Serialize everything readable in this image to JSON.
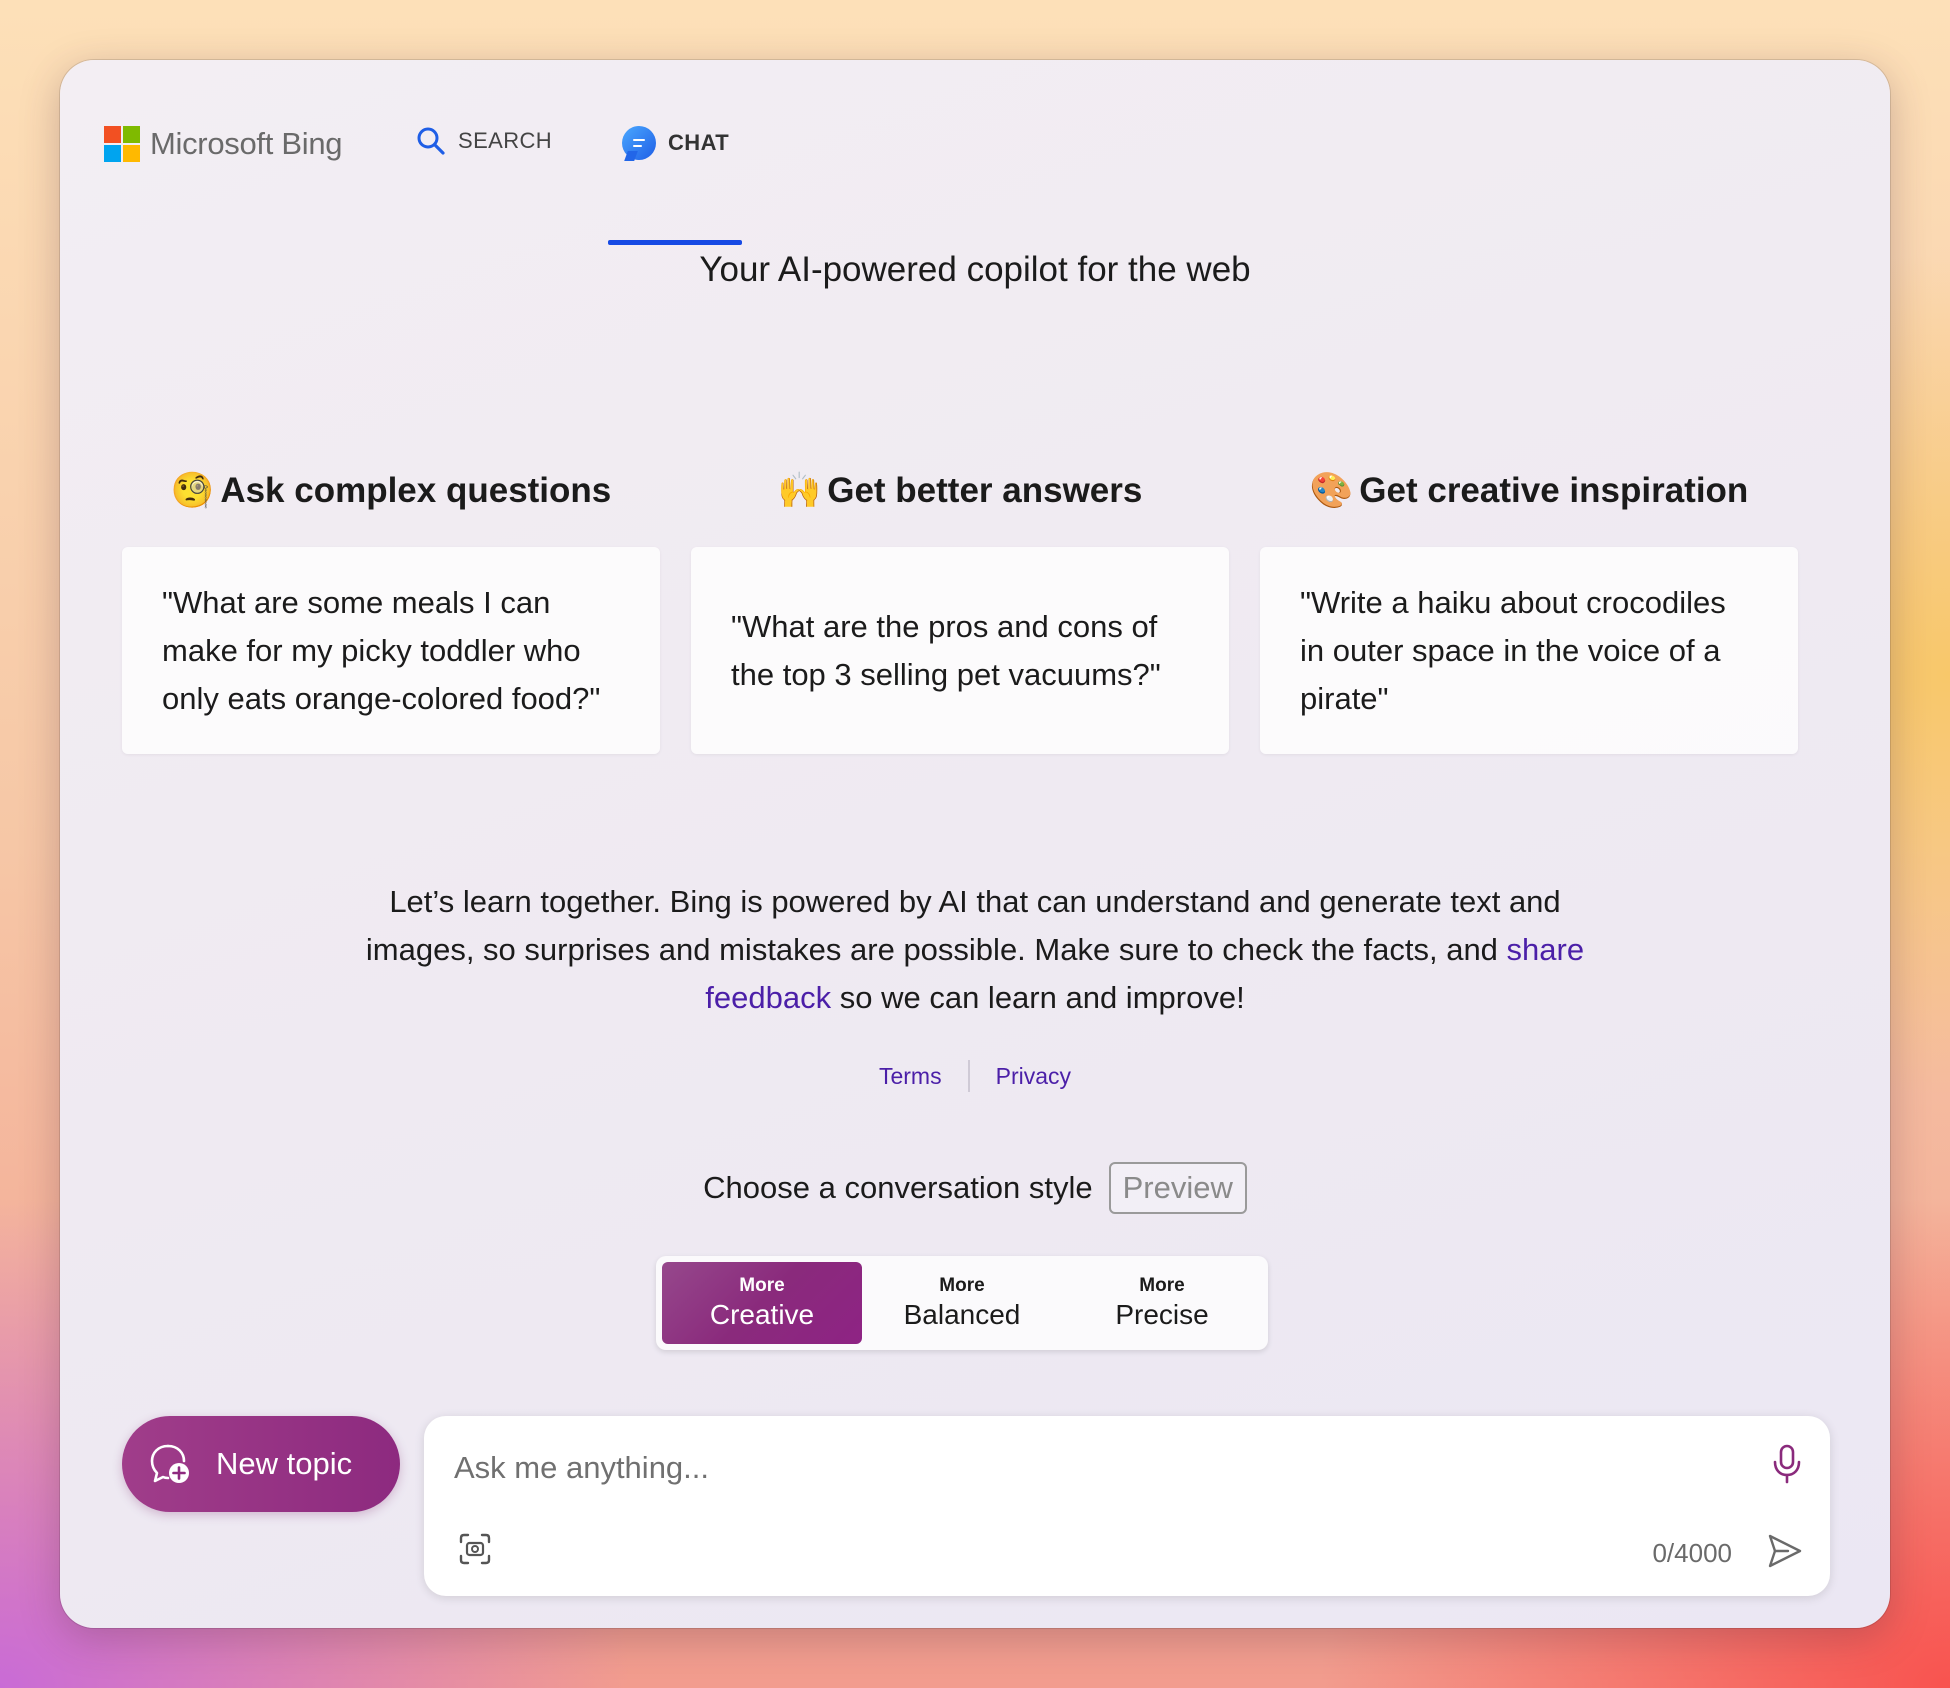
{
  "header": {
    "logo_text": "Microsoft Bing",
    "tabs": [
      {
        "label": "SEARCH",
        "icon": "search-icon",
        "active": false
      },
      {
        "label": "CHAT",
        "icon": "chat-bubble-icon",
        "active": true
      }
    ],
    "accent_color": "#174ae4"
  },
  "tagline": "Your AI-powered copilot for the web",
  "features": [
    {
      "emoji": "🧐",
      "title": "Ask complex questions",
      "example": "\"What are some meals I can make for my picky toddler who only eats orange-colored food?\""
    },
    {
      "emoji": "🙌",
      "title": "Get better answers",
      "example": "\"What are the pros and cons of the top 3 selling pet vacuums?\""
    },
    {
      "emoji": "🎨",
      "title": "Get creative inspiration",
      "example": "\"Write a haiku about crocodiles in outer space in the voice of a pirate\""
    }
  ],
  "disclaimer": {
    "text_before": "Let’s learn together. Bing is powered by AI that can understand and generate text and images, so surprises and mistakes are possible. Make sure to check the facts, and ",
    "link": "share feedback",
    "text_after": " so we can learn and improve!"
  },
  "links": {
    "terms": "Terms",
    "privacy": "Privacy"
  },
  "conversation_style": {
    "label": "Choose a conversation style",
    "badge": "Preview",
    "options": [
      {
        "small": "More",
        "big": "Creative",
        "active": true
      },
      {
        "small": "More",
        "big": "Balanced",
        "active": false
      },
      {
        "small": "More",
        "big": "Precise",
        "active": false
      }
    ],
    "active_color": "#8a2a7c"
  },
  "composer": {
    "new_topic_label": "New topic",
    "placeholder": "Ask me anything...",
    "counter": "0/4000"
  }
}
